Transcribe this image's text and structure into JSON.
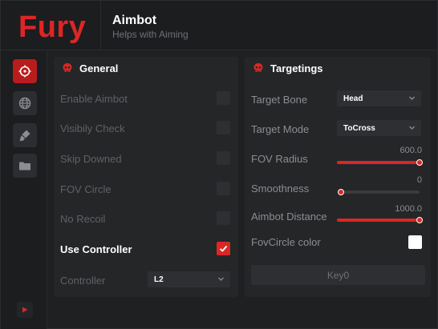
{
  "header": {
    "logo": "Fury",
    "title": "Aimbot",
    "subtitle": "Helps with Aiming"
  },
  "sidebar": {
    "items": [
      {
        "icon": "crosshair-icon",
        "active": true
      },
      {
        "icon": "globe-icon",
        "active": false
      },
      {
        "icon": "paint-brush-icon",
        "active": false
      },
      {
        "icon": "folder-icon",
        "active": false
      }
    ],
    "bottom_icon": "play-icon"
  },
  "general": {
    "title": "General",
    "items": [
      {
        "label": "Enable Aimbot",
        "checked": false
      },
      {
        "label": "Visibily Check",
        "checked": false
      },
      {
        "label": "Skip Downed",
        "checked": false
      },
      {
        "label": "FOV Circle",
        "checked": false
      },
      {
        "label": "No Recoil",
        "checked": false
      },
      {
        "label": "Use Controller",
        "checked": true
      }
    ],
    "controller": {
      "label": "Controller",
      "value": "L2"
    }
  },
  "targetings": {
    "title": "Targetings",
    "target_bone": {
      "label": "Target Bone",
      "value": "Head"
    },
    "target_mode": {
      "label": "Target Mode",
      "value": "ToCross"
    },
    "fov_radius": {
      "label": "FOV Radius",
      "value": "600.0",
      "fraction": 1.0
    },
    "smoothness": {
      "label": "Smoothness",
      "value": "0",
      "fraction": 0.0
    },
    "aimbot_distance": {
      "label": "Aimbot Distance",
      "value": "1000.0",
      "fraction": 1.0
    },
    "fov_circle_color": {
      "label": "FovCircle color",
      "color": "#ffffff"
    },
    "key": {
      "label": "Key0"
    }
  },
  "colors": {
    "accent": "#dc2626",
    "background": "#1f2022",
    "panel": "#252628"
  }
}
